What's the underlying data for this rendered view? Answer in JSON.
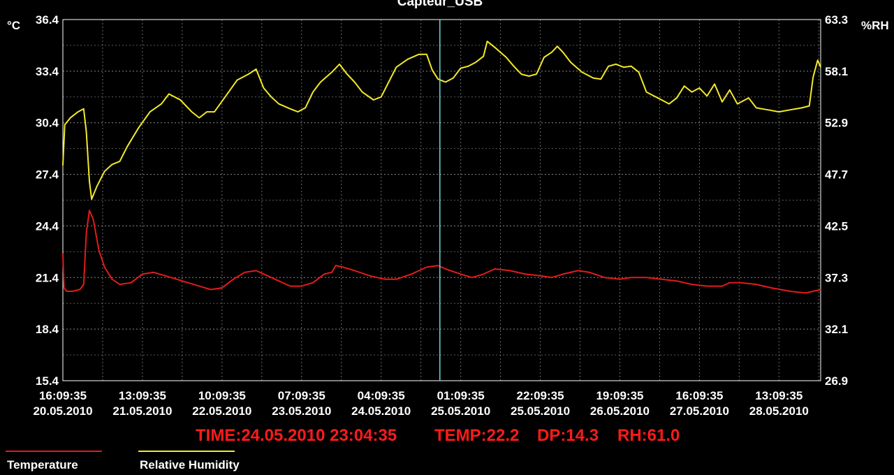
{
  "chart_data": {
    "type": "line",
    "title": "Capteur_USB",
    "left_axis": {
      "unit": "°C",
      "ylim": [
        15.4,
        36.4
      ],
      "ticks": [
        "36.4",
        "33.4",
        "30.4",
        "27.4",
        "24.4",
        "21.4",
        "18.4",
        "15.4"
      ]
    },
    "right_axis": {
      "unit": "%RH",
      "ylim": [
        26.9,
        63.3
      ],
      "ticks": [
        "63.3",
        "58.1",
        "52.9",
        "47.7",
        "42.5",
        "37.3",
        "32.1",
        "26.9"
      ]
    },
    "x_ticks": [
      {
        "time": "16:09:35",
        "date": "20.05.2010"
      },
      {
        "time": "13:09:35",
        "date": "21.05.2010"
      },
      {
        "time": "10:09:35",
        "date": "22.05.2010"
      },
      {
        "time": "07:09:35",
        "date": "23.05.2010"
      },
      {
        "time": "04:09:35",
        "date": "24.05.2010"
      },
      {
        "time": "01:09:35",
        "date": "25.05.2010"
      },
      {
        "time": "22:09:35",
        "date": "25.05.2010"
      },
      {
        "time": "19:09:35",
        "date": "26.05.2010"
      },
      {
        "time": "16:09:35",
        "date": "27.05.2010"
      },
      {
        "time": "13:09:35",
        "date": "28.05.2010"
      }
    ],
    "grid": true,
    "x_tick_interval_hours": 21,
    "x_range_hours": [
      0,
      200
    ],
    "series": [
      {
        "name": "Temperature",
        "axis": "left",
        "color": "#e31b1b",
        "points": [
          [
            0,
            22.8
          ],
          [
            0.3,
            20.8
          ],
          [
            1,
            20.6
          ],
          [
            2.5,
            20.6
          ],
          [
            4.5,
            20.7
          ],
          [
            5.5,
            21.0
          ],
          [
            6.2,
            24.0
          ],
          [
            7,
            25.3
          ],
          [
            8,
            24.8
          ],
          [
            9.5,
            23.0
          ],
          [
            11,
            22.0
          ],
          [
            13,
            21.3
          ],
          [
            15,
            21.0
          ],
          [
            18,
            21.1
          ],
          [
            21,
            21.6
          ],
          [
            24,
            21.7
          ],
          [
            27,
            21.5
          ],
          [
            30,
            21.3
          ],
          [
            33,
            21.1
          ],
          [
            36,
            20.9
          ],
          [
            39,
            20.7
          ],
          [
            42,
            20.8
          ],
          [
            45,
            21.3
          ],
          [
            48,
            21.7
          ],
          [
            51,
            21.8
          ],
          [
            54,
            21.5
          ],
          [
            57,
            21.2
          ],
          [
            60,
            20.9
          ],
          [
            63,
            20.9
          ],
          [
            66,
            21.1
          ],
          [
            69,
            21.6
          ],
          [
            71,
            21.7
          ],
          [
            72,
            22.1
          ],
          [
            74,
            22.0
          ],
          [
            77,
            21.8
          ],
          [
            81,
            21.5
          ],
          [
            85,
            21.3
          ],
          [
            88,
            21.3
          ],
          [
            92,
            21.6
          ],
          [
            96,
            22.0
          ],
          [
            99,
            22.1
          ],
          [
            101,
            21.9
          ],
          [
            105,
            21.6
          ],
          [
            108,
            21.4
          ],
          [
            111,
            21.6
          ],
          [
            114,
            21.9
          ],
          [
            118,
            21.8
          ],
          [
            122,
            21.6
          ],
          [
            126,
            21.5
          ],
          [
            129,
            21.4
          ],
          [
            132,
            21.6
          ],
          [
            136,
            21.8
          ],
          [
            139,
            21.7
          ],
          [
            143,
            21.4
          ],
          [
            147,
            21.3
          ],
          [
            150,
            21.4
          ],
          [
            154,
            21.4
          ],
          [
            158,
            21.3
          ],
          [
            162,
            21.2
          ],
          [
            166,
            21.0
          ],
          [
            170,
            20.9
          ],
          [
            174,
            20.9
          ],
          [
            176,
            21.1
          ],
          [
            179,
            21.1
          ],
          [
            183,
            21.0
          ],
          [
            187,
            20.8
          ],
          [
            192,
            20.6
          ],
          [
            196,
            20.5
          ],
          [
            198,
            20.6
          ],
          [
            200,
            20.7
          ]
        ]
      },
      {
        "name": "Relative Humidity",
        "axis": "right",
        "color": "#f2ea27",
        "points": [
          [
            0,
            48.6
          ],
          [
            0.5,
            52.7
          ],
          [
            2,
            53.4
          ],
          [
            4,
            54.0
          ],
          [
            5.5,
            54.3
          ],
          [
            6.2,
            52.0
          ],
          [
            7,
            47.0
          ],
          [
            7.6,
            45.2
          ],
          [
            9,
            46.5
          ],
          [
            11,
            48.0
          ],
          [
            13,
            48.7
          ],
          [
            15,
            49.0
          ],
          [
            17,
            50.5
          ],
          [
            20,
            52.4
          ],
          [
            23,
            54.0
          ],
          [
            26,
            54.8
          ],
          [
            28,
            55.8
          ],
          [
            31,
            55.2
          ],
          [
            34,
            54.0
          ],
          [
            36,
            53.4
          ],
          [
            38,
            54.0
          ],
          [
            40,
            54.0
          ],
          [
            43,
            55.6
          ],
          [
            46,
            57.2
          ],
          [
            49,
            57.8
          ],
          [
            51,
            58.3
          ],
          [
            53,
            56.4
          ],
          [
            55,
            55.5
          ],
          [
            57,
            54.8
          ],
          [
            60,
            54.3
          ],
          [
            62,
            54.0
          ],
          [
            64,
            54.4
          ],
          [
            66,
            56.0
          ],
          [
            68,
            57.0
          ],
          [
            71,
            58.0
          ],
          [
            73,
            58.8
          ],
          [
            75,
            57.8
          ],
          [
            77,
            57.0
          ],
          [
            79,
            56.0
          ],
          [
            82,
            55.2
          ],
          [
            84,
            55.5
          ],
          [
            86,
            57.0
          ],
          [
            88,
            58.5
          ],
          [
            91,
            59.3
          ],
          [
            94,
            59.8
          ],
          [
            96,
            59.8
          ],
          [
            97.5,
            58.2
          ],
          [
            99,
            57.3
          ],
          [
            101,
            57.0
          ],
          [
            103,
            57.4
          ],
          [
            105,
            58.4
          ],
          [
            107,
            58.6
          ],
          [
            109,
            59.0
          ],
          [
            111,
            59.6
          ],
          [
            112,
            61.1
          ],
          [
            114,
            60.5
          ],
          [
            117,
            59.5
          ],
          [
            119,
            58.6
          ],
          [
            121,
            57.8
          ],
          [
            123,
            57.6
          ],
          [
            125,
            57.8
          ],
          [
            127,
            59.5
          ],
          [
            129,
            60.0
          ],
          [
            130.5,
            60.6
          ],
          [
            132,
            60.0
          ],
          [
            134,
            59.0
          ],
          [
            137,
            58.0
          ],
          [
            140,
            57.4
          ],
          [
            142,
            57.3
          ],
          [
            144,
            58.6
          ],
          [
            146,
            58.8
          ],
          [
            148,
            58.5
          ],
          [
            150,
            58.6
          ],
          [
            152,
            58.0
          ],
          [
            154,
            56.0
          ],
          [
            156,
            55.6
          ],
          [
            158,
            55.2
          ],
          [
            160,
            54.8
          ],
          [
            162,
            55.4
          ],
          [
            164,
            56.6
          ],
          [
            166,
            56.0
          ],
          [
            168,
            56.4
          ],
          [
            170,
            55.6
          ],
          [
            172,
            56.8
          ],
          [
            174,
            55.0
          ],
          [
            176,
            56.2
          ],
          [
            178,
            54.8
          ],
          [
            181,
            55.4
          ],
          [
            183,
            54.4
          ],
          [
            186,
            54.2
          ],
          [
            189,
            54.0
          ],
          [
            192,
            54.2
          ],
          [
            195,
            54.4
          ],
          [
            197,
            54.6
          ],
          [
            198,
            57.5
          ],
          [
            199.2,
            59.2
          ],
          [
            200,
            58.5
          ]
        ]
      }
    ],
    "cursor": {
      "x_hours": 99.5,
      "color": "#6ad7e3"
    },
    "readout": {
      "time": "TIME:24.05.2010 23:04:35",
      "temp": "TEMP:22.2",
      "dp": "DP:14.3",
      "rh": "RH:61.0"
    }
  },
  "legend": [
    {
      "label": "Temperature",
      "color": "#e31b1b"
    },
    {
      "label": "Relative Humidity",
      "color": "#f2ea27"
    }
  ]
}
